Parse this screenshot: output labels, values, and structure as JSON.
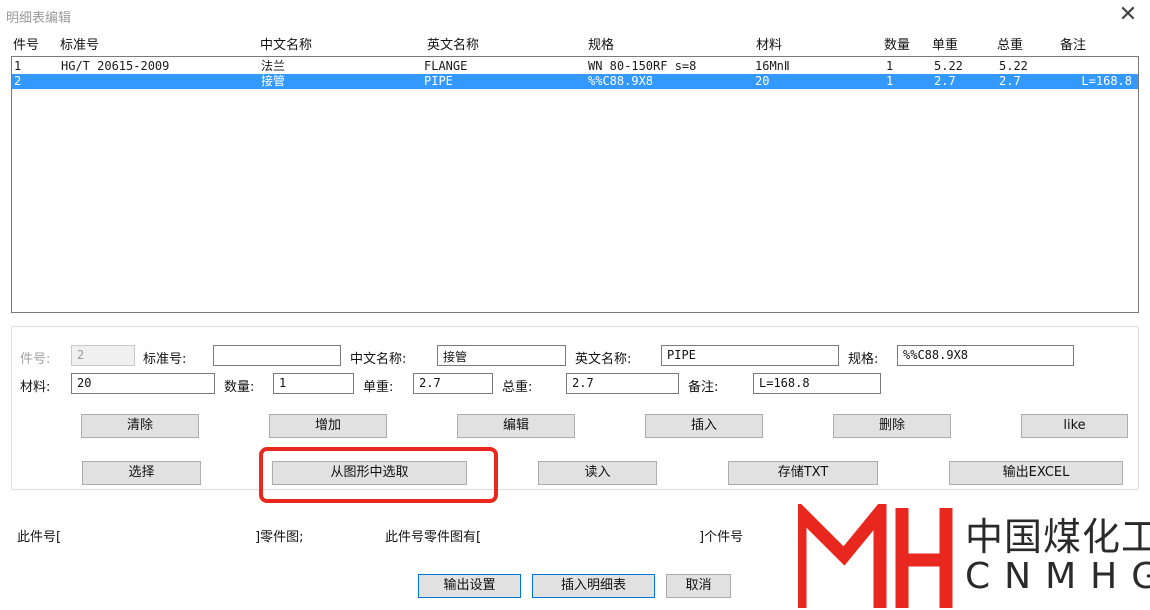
{
  "window": {
    "title": "明细表编辑",
    "close_glyph": "✕"
  },
  "list": {
    "columns": [
      "件号",
      "标准号",
      "中文名称",
      "英文名称",
      "规格",
      "材料",
      "数量",
      "单重",
      "总重",
      "备注"
    ],
    "rows": [
      {
        "no": "1",
        "std": "HG/T 20615-2009",
        "cn": "法兰",
        "en": "FLANGE",
        "spec": "WN 80-150RF s=8",
        "mat": "16MnⅡ",
        "qty": "1",
        "unit": "5.22",
        "total": "5.22",
        "note": "",
        "selected": false
      },
      {
        "no": "2",
        "std": "",
        "cn": "接管",
        "en": "PIPE",
        "spec": "%%C88.9X8",
        "mat": "20",
        "qty": "1",
        "unit": "2.7",
        "total": "2.7",
        "note": "L=168.8",
        "selected": true
      }
    ]
  },
  "form": {
    "part_no": {
      "label": "件号:",
      "value": "2"
    },
    "std_no": {
      "label": "标准号:",
      "value": ""
    },
    "cn_name": {
      "label": "中文名称:",
      "value": "接管"
    },
    "en_name": {
      "label": "英文名称:",
      "value": "PIPE"
    },
    "spec": {
      "label": "规格:",
      "value": "%%C88.9X8"
    },
    "material": {
      "label": "材料:",
      "value": "20"
    },
    "qty": {
      "label": "数量:",
      "value": "1"
    },
    "unit_wt": {
      "label": "单重:",
      "value": "2.7"
    },
    "total_wt": {
      "label": "总重:",
      "value": "2.7"
    },
    "note": {
      "label": "备注:",
      "value": "L=168.8"
    }
  },
  "buttons": {
    "clear": "清除",
    "add": "增加",
    "edit": "编辑",
    "insert": "插入",
    "delete": "删除",
    "like": "like",
    "select": "选择",
    "pick": "从图形中选取",
    "read": "读入",
    "save_txt": "存储TXT",
    "export_excel": "输出EXCEL"
  },
  "status": {
    "part_prefix": "此件号[",
    "part_suffix": "]零件图;",
    "has_prefix": "此件号零件图有[",
    "has_suffix": "]个件号"
  },
  "bottom": {
    "output_settings": "输出设置",
    "insert_table": "插入明细表",
    "cancel": "取消"
  },
  "logo": {
    "cn": "中国煤化工",
    "en": "CNMHG",
    "color": "#e8271f"
  }
}
